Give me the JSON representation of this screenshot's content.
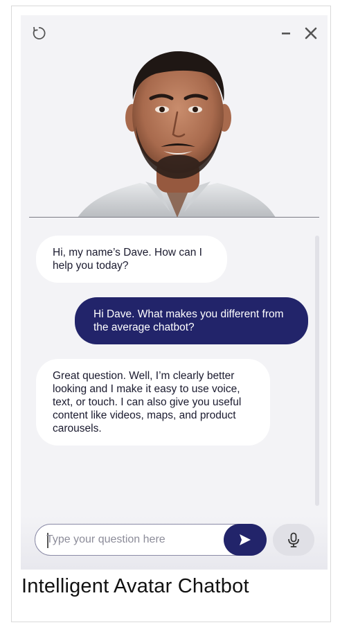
{
  "widget": {
    "avatar_name": "Dave",
    "accent_color": "#22246a"
  },
  "messages": [
    {
      "sender": "bot",
      "text": "Hi, my name’s Dave. How can I help you today?"
    },
    {
      "sender": "user",
      "text": "Hi Dave. What makes you different from the average chatbot?"
    },
    {
      "sender": "bot",
      "text": "Great question. Well, I’m clearly better looking and I make it easy to use voice, text, or touch. I can also give you useful content like videos, maps, and product carousels."
    }
  ],
  "input": {
    "placeholder": "Type your question here"
  },
  "icons": {
    "reset": "reset-icon",
    "minimize": "minimize-icon",
    "close": "close-icon",
    "send": "send-icon",
    "mic": "microphone-icon"
  },
  "caption": "Intelligent Avatar Chatbot"
}
